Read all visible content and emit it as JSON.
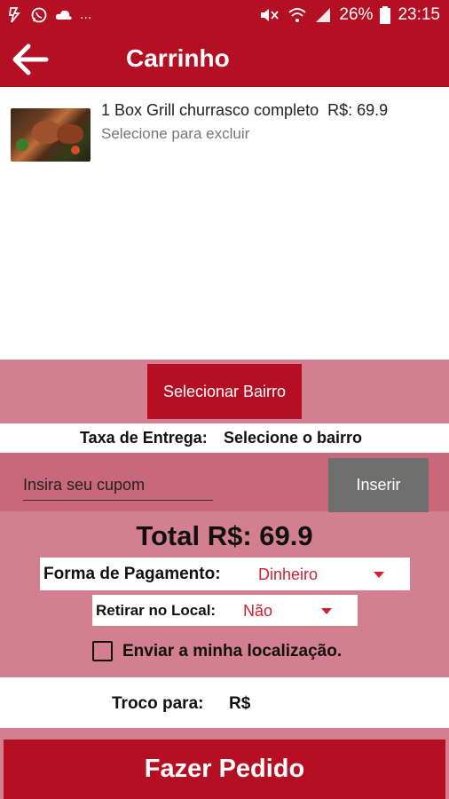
{
  "status_bar": {
    "dots": "...",
    "battery": "26%",
    "time": "23:15"
  },
  "app_bar": {
    "title": "Carrinho"
  },
  "cart": {
    "items": [
      {
        "description": "1 Box Grill churrasco completo",
        "price": "R$: 69.9",
        "hint": "Selecione para excluir"
      }
    ]
  },
  "delivery": {
    "select_bairro_label": "Selecionar Bairro",
    "fee_label": "Taxa de Entrega:",
    "fee_value": "Selecione o bairro"
  },
  "coupon": {
    "placeholder": "Insira seu cupom",
    "button_label": "Inserir"
  },
  "total": {
    "label": "Total R$: 69.9"
  },
  "payment": {
    "label": "Forma de Pagamento:",
    "value": "Dinheiro"
  },
  "pickup": {
    "label": "Retirar no Local:",
    "value": "Não"
  },
  "location": {
    "label": "Enviar a minha localização."
  },
  "change": {
    "label": "Troco para:",
    "currency": "R$"
  },
  "order_button": "Fazer Pedido",
  "colors": {
    "brand_red": "#b50f24",
    "panel_pink": "#d37f8f",
    "accent_red_text": "#d01f2f",
    "button_grey": "#6f6f6f"
  }
}
